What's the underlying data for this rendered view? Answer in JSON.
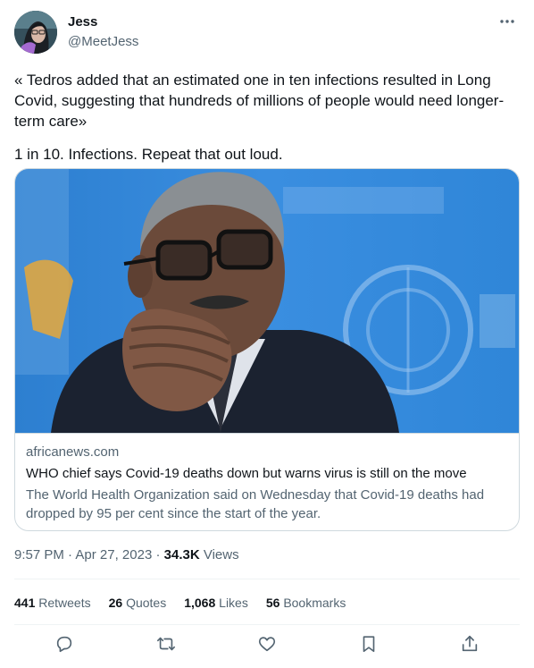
{
  "author": {
    "name": "Jess",
    "handle": "@MeetJess"
  },
  "tweet": {
    "paragraphs": [
      "« Tedros added that an estimated one in ten infections resulted in Long Covid, suggesting that hundreds of millions of people would need longer-term care»",
      "1 in 10. Infections. Repeat that out loud."
    ]
  },
  "card": {
    "domain": "africanews.com",
    "title": "WHO chief says Covid-19 deaths down but warns virus is still on the move",
    "description": "The World Health Organization said on Wednesday that Covid-19 deaths had dropped by 95 per cent since the start of the year."
  },
  "meta": {
    "time": "9:57 PM",
    "date": "Apr 27, 2023",
    "separator": " · ",
    "views_count": "34.3K",
    "views_label": "Views"
  },
  "stats": {
    "retweets": {
      "count": "441",
      "label": "Retweets"
    },
    "quotes": {
      "count": "26",
      "label": "Quotes"
    },
    "likes": {
      "count": "1,068",
      "label": "Likes"
    },
    "bookmarks": {
      "count": "56",
      "label": "Bookmarks"
    }
  },
  "actions": [
    "reply-icon",
    "retweet-icon",
    "like-icon",
    "bookmark-icon",
    "share-icon"
  ],
  "colors": {
    "text": "#0f1419",
    "secondary": "#536471",
    "border": "#cfd9de",
    "divider": "#eff3f4"
  }
}
